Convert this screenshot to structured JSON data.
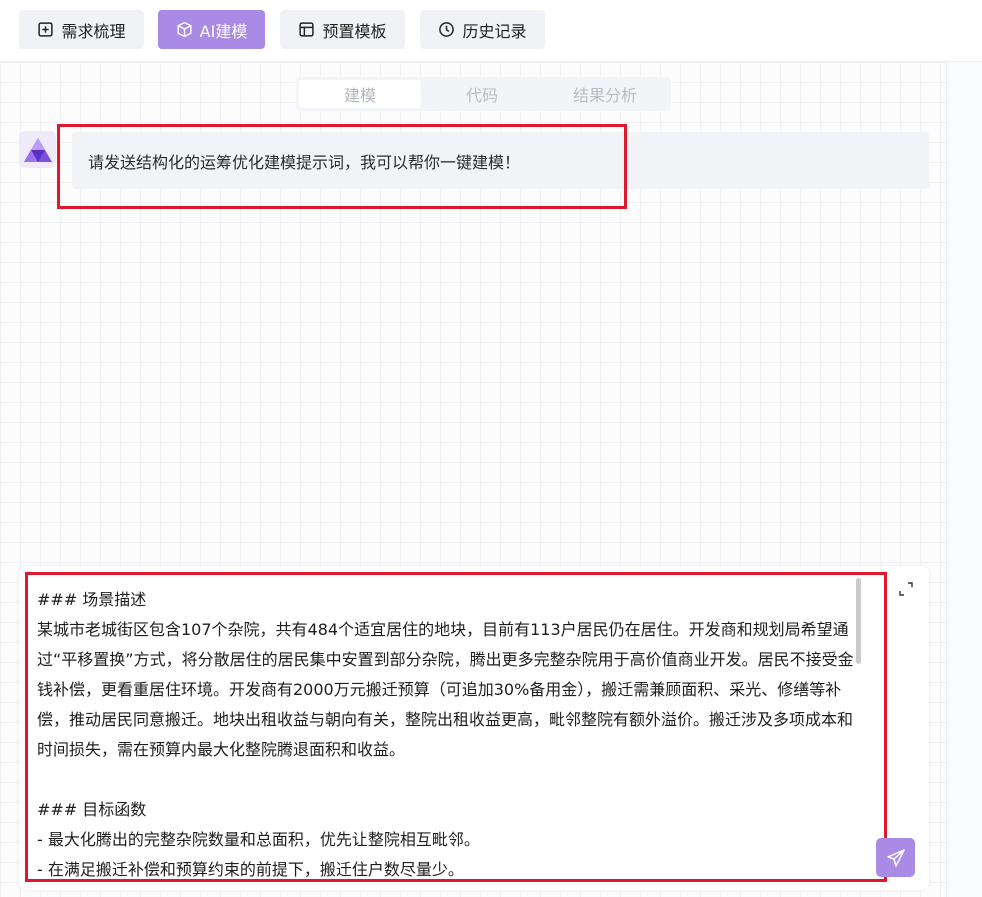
{
  "toolbar": {
    "buttons": [
      {
        "label": "需求梳理",
        "icon": "plus-square-icon"
      },
      {
        "label": "AI建模",
        "icon": "cube-icon"
      },
      {
        "label": "预置模板",
        "icon": "layout-template-icon"
      },
      {
        "label": "历史记录",
        "icon": "clock-icon"
      }
    ],
    "active_index": 1
  },
  "tabs": {
    "items": [
      "建模",
      "代码",
      "结果分析"
    ],
    "active_index": 0
  },
  "chat": {
    "assistant_message": "请发送结构化的运筹优化建模提示词，我可以帮你一键建模！"
  },
  "input": {
    "value": "### 场景描述\n某城市老城街区包含107个杂院，共有484个适宜居住的地块，目前有113户居民仍在居住。开发商和规划局希望通过“平移置换”方式，将分散居住的居民集中安置到部分杂院，腾出更多完整杂院用于高价值商业开发。居民不接受金钱补偿，更看重居住环境。开发商有2000万元搬迁预算（可追加30%备用金），搬迁需兼顾面积、采光、修缮等补偿，推动居民同意搬迁。地块出租收益与朝向有关，整院出租收益更高，毗邻整院有额外溢价。搬迁涉及多项成本和时间损失，需在预算内最大化整院腾退面积和收益。\n\n### 目标函数\n- 最大化腾出的完整杂院数量和总面积，优先让整院相互毗邻。\n- 在满足搬迁补偿和预算约束的前提下，搬迁住户数尽量少。"
  },
  "colors": {
    "accent": "#a98ae4",
    "highlight_border": "#e0182d"
  }
}
